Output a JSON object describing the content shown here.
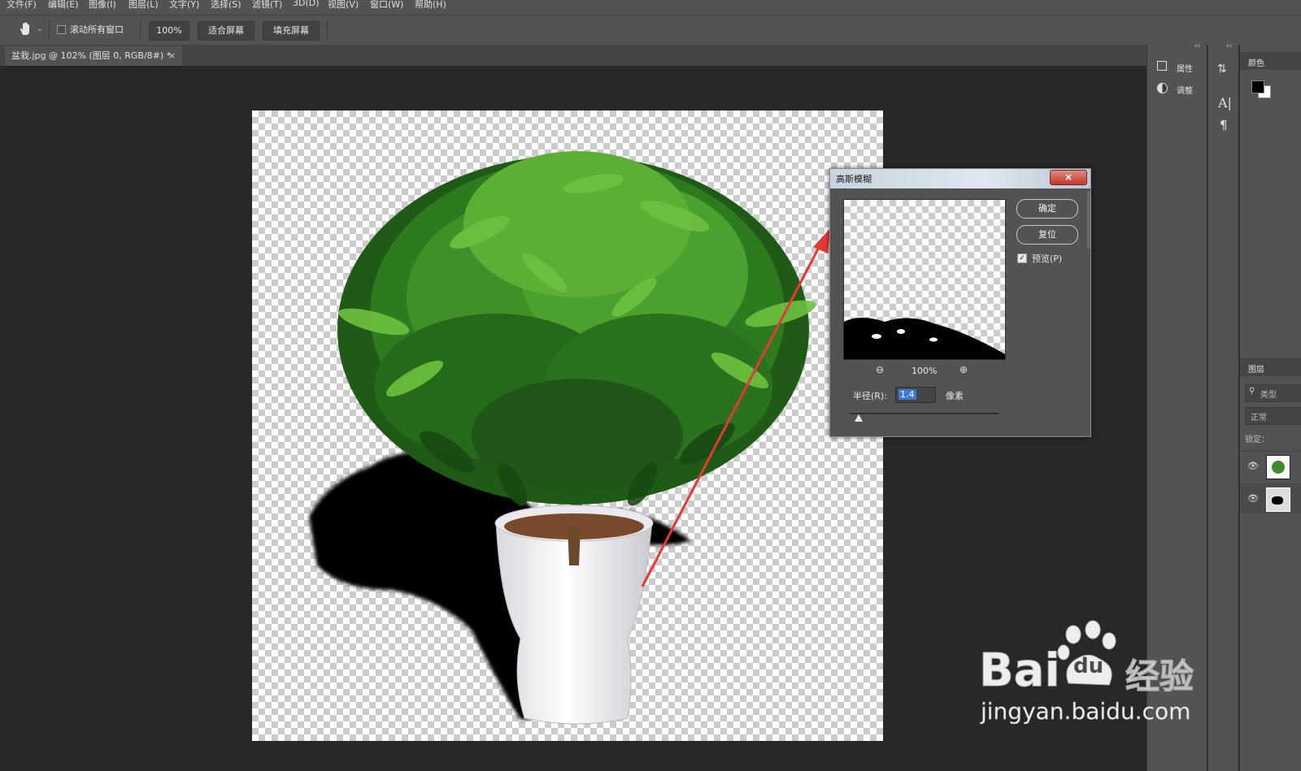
{
  "menu": [
    "文件(F)",
    "编辑(E)",
    "图像(I)",
    "图层(L)",
    "文字(Y)",
    "选择(S)",
    "滤镜(T)",
    "3D(D)",
    "视图(V)",
    "窗口(W)",
    "帮助(H)"
  ],
  "options": {
    "scroll_all_label": "滚动所有窗口",
    "zoom_value": "100%",
    "fit_screen": "适合屏幕",
    "fill_screen": "填充屏幕"
  },
  "document_tab": {
    "title": "盆栽.jpg @ 102% (图层 0, RGB/8#) *",
    "close": "×"
  },
  "panels": {
    "collapse": "‹‹",
    "properties": "属性",
    "adjustments": "调整",
    "color": "颜色",
    "layers": "图层",
    "layer_search": "类型",
    "blend_mode": "正常",
    "lock": "锁定："
  },
  "dialog": {
    "title": "高斯模糊",
    "close": "×",
    "ok": "确定",
    "reset": "复位",
    "preview_label": "预览(P)",
    "preview_checked": true,
    "zoom": "100%",
    "radius_label": "半径(R):",
    "radius_value": "1.4",
    "radius_unit": "像素"
  },
  "watermark": {
    "brand": "Bai",
    "paw_text": "du",
    "suffix": "经验",
    "url": "jingyan.baidu.com"
  },
  "colors": {
    "ui_bg": "#535353",
    "canvas_bg": "#282828",
    "arrow": "#e53935",
    "selection": "#3a7bd5"
  }
}
